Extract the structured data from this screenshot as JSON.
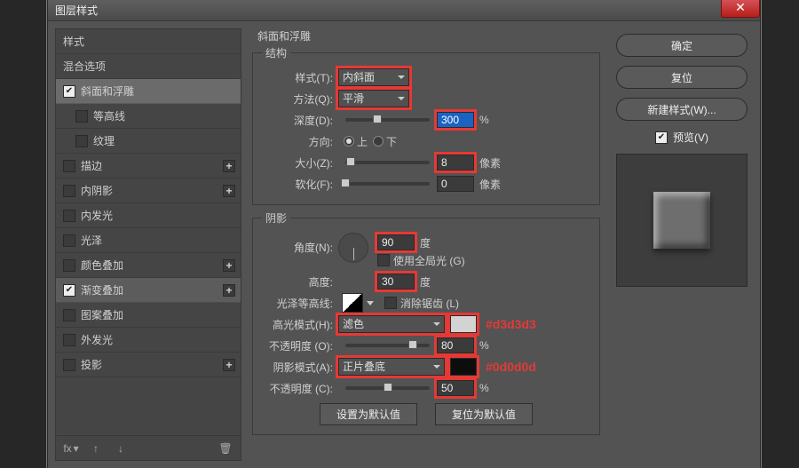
{
  "window_title": "图层样式",
  "styles_panel": {
    "header1": "样式",
    "header2": "混合选项",
    "items": [
      {
        "label": "斜面和浮雕",
        "checked": true,
        "selected": true
      },
      {
        "label": "等高线",
        "checked": false,
        "indent": true
      },
      {
        "label": "纹理",
        "checked": false,
        "indent": true
      },
      {
        "label": "描边",
        "checked": false,
        "plus": true
      },
      {
        "label": "内阴影",
        "checked": false,
        "plus": true
      },
      {
        "label": "内发光",
        "checked": false
      },
      {
        "label": "光泽",
        "checked": false
      },
      {
        "label": "颜色叠加",
        "checked": false,
        "plus": true
      },
      {
        "label": "渐变叠加",
        "checked": true,
        "plus": true,
        "extra_sel": true
      },
      {
        "label": "图案叠加",
        "checked": false
      },
      {
        "label": "外发光",
        "checked": false
      },
      {
        "label": "投影",
        "checked": false,
        "plus": true
      }
    ],
    "footer": {
      "fx": "fx"
    }
  },
  "section_title": "斜面和浮雕",
  "structure": {
    "legend": "结构",
    "style_label": "样式(T):",
    "style_value": "内斜面",
    "method_label": "方法(Q):",
    "method_value": "平滑",
    "depth_label": "深度(D):",
    "depth_value": "300",
    "depth_unit": "%",
    "direction_label": "方向:",
    "dir_up": "上",
    "dir_down": "下",
    "size_label": "大小(Z):",
    "size_value": "8",
    "size_unit": "像素",
    "soften_label": "软化(F):",
    "soften_value": "0",
    "soften_unit": "像素"
  },
  "shadow": {
    "legend": "阴影",
    "angle_label": "角度(N):",
    "angle_value": "90",
    "angle_unit": "度",
    "global_label": "使用全局光 (G)",
    "altitude_label": "高度:",
    "altitude_value": "30",
    "altitude_unit": "度",
    "gloss_label": "光泽等高线:",
    "antialias_label": "消除锯齿 (L)",
    "hmode_label": "高光模式(H):",
    "hmode_value": "滤色",
    "hmode_color": "#d3d3d3",
    "hmode_annot": "#d3d3d3",
    "hopacity_label": "不透明度 (O):",
    "hopacity_value": "80",
    "hopacity_unit": "%",
    "smode_label": "阴影模式(A):",
    "smode_value": "正片叠底",
    "smode_color": "#0d0d0d",
    "smode_annot": "#0d0d0d",
    "sopacity_label": "不透明度 (C):",
    "sopacity_value": "50",
    "sopacity_unit": "%"
  },
  "buttons": {
    "default": "设置为默认值",
    "reset": "复位为默认值"
  },
  "right": {
    "ok": "确定",
    "cancel": "复位",
    "new_style": "新建样式(W)...",
    "preview": "预览(V)"
  }
}
